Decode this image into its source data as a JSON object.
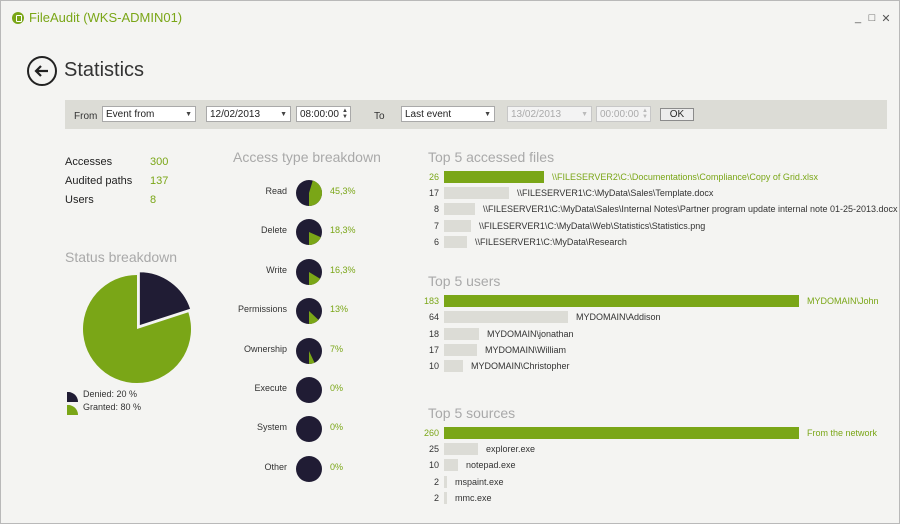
{
  "app": {
    "title": "FileAudit (WKS-ADMIN01)"
  },
  "window_controls": {
    "minimize": "_",
    "maximize": "□",
    "close": "✕"
  },
  "page": {
    "title": "Statistics"
  },
  "filter": {
    "from_label": "From",
    "from_mode": "Event from",
    "from_date": "12/02/2013",
    "from_time": "08:00:00",
    "to_label": "To",
    "to_mode": "Last event",
    "to_date": "13/02/2013",
    "to_time": "00:00:00",
    "ok_label": "OK"
  },
  "summary": {
    "accesses_label": "Accesses",
    "accesses_value": "300",
    "paths_label": "Audited paths",
    "paths_value": "137",
    "users_label": "Users",
    "users_value": "8"
  },
  "status_breakdown": {
    "title": "Status breakdown",
    "denied_label": "Denied: 20 %",
    "denied_fraction": 0.2,
    "granted_label": "Granted: 80 %",
    "granted_fraction": 0.8,
    "colors": {
      "denied": "#201c34",
      "granted": "#7aa617"
    }
  },
  "access_types": {
    "title": "Access type breakdown",
    "items": [
      {
        "label": "Read",
        "pct": "45,3%",
        "fraction": 0.453
      },
      {
        "label": "Delete",
        "pct": "18,3%",
        "fraction": 0.183
      },
      {
        "label": "Write",
        "pct": "16,3%",
        "fraction": 0.163
      },
      {
        "label": "Permissions",
        "pct": "13%",
        "fraction": 0.13
      },
      {
        "label": "Ownership",
        "pct": "7%",
        "fraction": 0.07
      },
      {
        "label": "Execute",
        "pct": "0%",
        "fraction": 0
      },
      {
        "label": "System",
        "pct": "0%",
        "fraction": 0
      },
      {
        "label": "Other",
        "pct": "0%",
        "fraction": 0
      }
    ]
  },
  "top_files": {
    "title": "Top 5 accessed files",
    "items": [
      {
        "count": "26",
        "label": "\\\\FILESERVER2\\C:\\Documentations\\Compliance\\Copy of Grid.xlsx",
        "highlight": true
      },
      {
        "count": "17",
        "label": "\\\\FILESERVER1\\C:\\MyData\\Sales\\Template.docx",
        "highlight": false
      },
      {
        "count": "8",
        "label": "\\\\FILESERVER1\\C:\\MyData\\Sales\\Internal Notes\\Partner program update internal note 01-25-2013.docx",
        "highlight": false
      },
      {
        "count": "7",
        "label": "\\\\FILESERVER1\\C:\\MyData\\Web\\Statistics\\Statistics.png",
        "highlight": false
      },
      {
        "count": "6",
        "label": "\\\\FILESERVER1\\C:\\MyData\\Research",
        "highlight": false
      }
    ]
  },
  "top_users": {
    "title": "Top 5 users",
    "items": [
      {
        "count": "183",
        "label": "MYDOMAIN\\John",
        "highlight": true
      },
      {
        "count": "64",
        "label": "MYDOMAIN\\Addison",
        "highlight": false
      },
      {
        "count": "18",
        "label": "MYDOMAIN\\jonathan",
        "highlight": false
      },
      {
        "count": "17",
        "label": "MYDOMAIN\\William",
        "highlight": false
      },
      {
        "count": "10",
        "label": "MYDOMAIN\\Christopher",
        "highlight": false
      }
    ]
  },
  "top_sources": {
    "title": "Top 5 sources",
    "items": [
      {
        "count": "260",
        "label": "From the network",
        "highlight": true
      },
      {
        "count": "25",
        "label": "explorer.exe",
        "highlight": false
      },
      {
        "count": "10",
        "label": "notepad.exe",
        "highlight": false
      },
      {
        "count": "2",
        "label": "mspaint.exe",
        "highlight": false
      },
      {
        "count": "2",
        "label": "mmc.exe",
        "highlight": false
      }
    ]
  },
  "colors": {
    "accent": "#7aa617",
    "dark": "#201c34",
    "bar_bg": "#dcdcd6"
  }
}
